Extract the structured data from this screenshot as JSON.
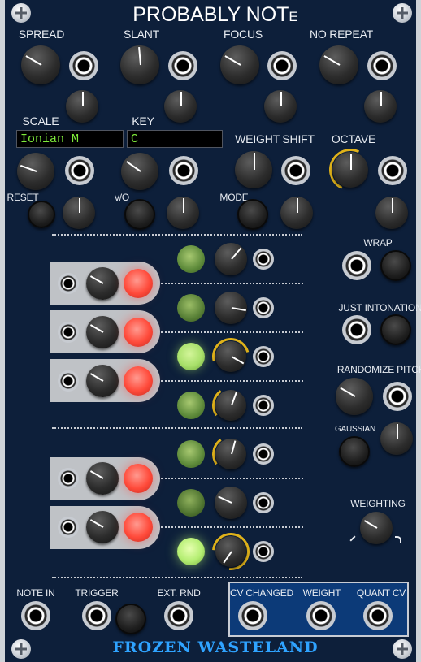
{
  "module": {
    "title_main": "PROBABLY NOT",
    "title_suffix": "E",
    "brand": "FROZEN WASTELAND"
  },
  "labels": {
    "spread": "SPREAD",
    "slant": "SLANT",
    "focus": "FOCUS",
    "no_repeat": "NO REPEAT",
    "scale": "SCALE",
    "key": "KEY",
    "weight_shift": "WEIGHT SHIFT",
    "octave": "OCTAVE",
    "reset": "RESET",
    "v_o": "v/O",
    "mode": "MODE",
    "wrap": "WRAP",
    "just_intonation": "JUST INTONATION",
    "randomize_pitch": "RANDOMIZE PITCH",
    "gaussian": "GAUSSIAN",
    "weighting": "WEIGHTING",
    "note_in": "NOTE IN",
    "trigger": "TRIGGER",
    "ext_rnd": "EXT. RND",
    "cv_changed": "CV CHANGED",
    "weight": "WEIGHT",
    "quant_cv": "QUANT CV"
  },
  "displays": {
    "scale_value": "Ionian M",
    "key_value": "C"
  },
  "colors": {
    "panel": "#0d1f3a",
    "display_text": "#7dea3a",
    "led_red": "#ff4a3a",
    "led_green_bright": "#a8e06a",
    "led_green_dim": "#5d8a3a",
    "arc_yellow": "#e0b21a",
    "output_box": "#0c3a78",
    "brand_text": "#2fa3ff"
  },
  "note_rows": [
    {
      "note_index": 1,
      "led_state": "dim",
      "sharp": false
    },
    {
      "note_index": 2,
      "led_state": "dim",
      "sharp": true
    },
    {
      "note_index": 3,
      "led_state": "bright",
      "sharp": false
    },
    {
      "note_index": 4,
      "led_state": "dim",
      "sharp": true
    },
    {
      "note_index": 5,
      "led_state": "bright",
      "sharp": false
    },
    {
      "note_index": 6,
      "led_state": "dim",
      "sharp": false
    },
    {
      "note_index": 7,
      "led_state": "dim",
      "sharp": true
    },
    {
      "note_index": 8,
      "led_state": "bright",
      "sharp": false
    },
    {
      "note_index": 9,
      "led_state": "dim",
      "sharp": true
    },
    {
      "note_index": 10,
      "led_state": "bright",
      "sharp": false
    },
    {
      "note_index": 11,
      "led_state": "bright",
      "sharp": true
    },
    {
      "note_index": 12,
      "led_state": "bright",
      "sharp": false
    }
  ],
  "icons": {
    "screw": "screw-icon",
    "jack": "jack-icon",
    "knob": "knob-icon"
  }
}
